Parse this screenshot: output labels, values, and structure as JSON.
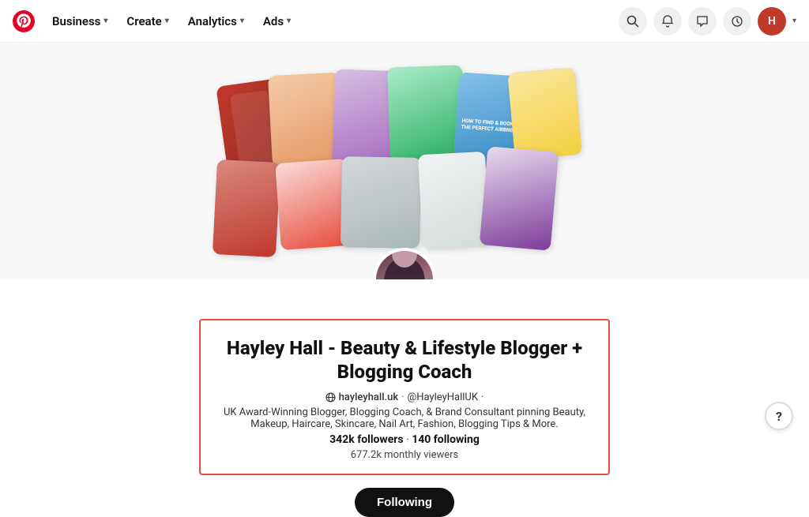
{
  "nav": {
    "logo_alt": "Pinterest",
    "items": [
      {
        "label": "Business",
        "id": "business"
      },
      {
        "label": "Create",
        "id": "create"
      },
      {
        "label": "Analytics",
        "id": "analytics"
      },
      {
        "label": "Ads",
        "id": "ads"
      }
    ],
    "icons": {
      "search": "🔍",
      "bell": "🔔",
      "chat": "💬",
      "notif": "🔔",
      "avatar_initials": "H"
    }
  },
  "profile": {
    "name": "Hayley Hall - Beauty & Lifestyle Blogger + Blogging Coach",
    "website": "hayleyhall.uk",
    "handle": "@HayleyHallUK",
    "bio": "UK Award-Winning Blogger, Blogging Coach, & Brand Consultant pinning Beauty, Makeup, Haircare, Skincare, Nail Art, Fashion, Blogging Tips & More.",
    "followers": "342k followers",
    "following": "140 following",
    "monthly_viewers": "677.2k monthly viewers",
    "follow_button": "Following"
  },
  "collage": {
    "pins": [
      {
        "id": "p1",
        "label": ""
      },
      {
        "id": "p2",
        "label": ""
      },
      {
        "id": "p3",
        "label": ""
      },
      {
        "id": "p4",
        "label": ""
      },
      {
        "id": "p5",
        "label": "HOW TO FIND & BOOK THE PERFECT AIRBNB"
      },
      {
        "id": "p6",
        "label": ""
      },
      {
        "id": "p7",
        "label": ""
      },
      {
        "id": "p8",
        "label": ""
      },
      {
        "id": "p9",
        "label": ""
      },
      {
        "id": "p10",
        "label": ""
      },
      {
        "id": "p11",
        "label": ""
      }
    ]
  },
  "help": {
    "label": "?"
  }
}
